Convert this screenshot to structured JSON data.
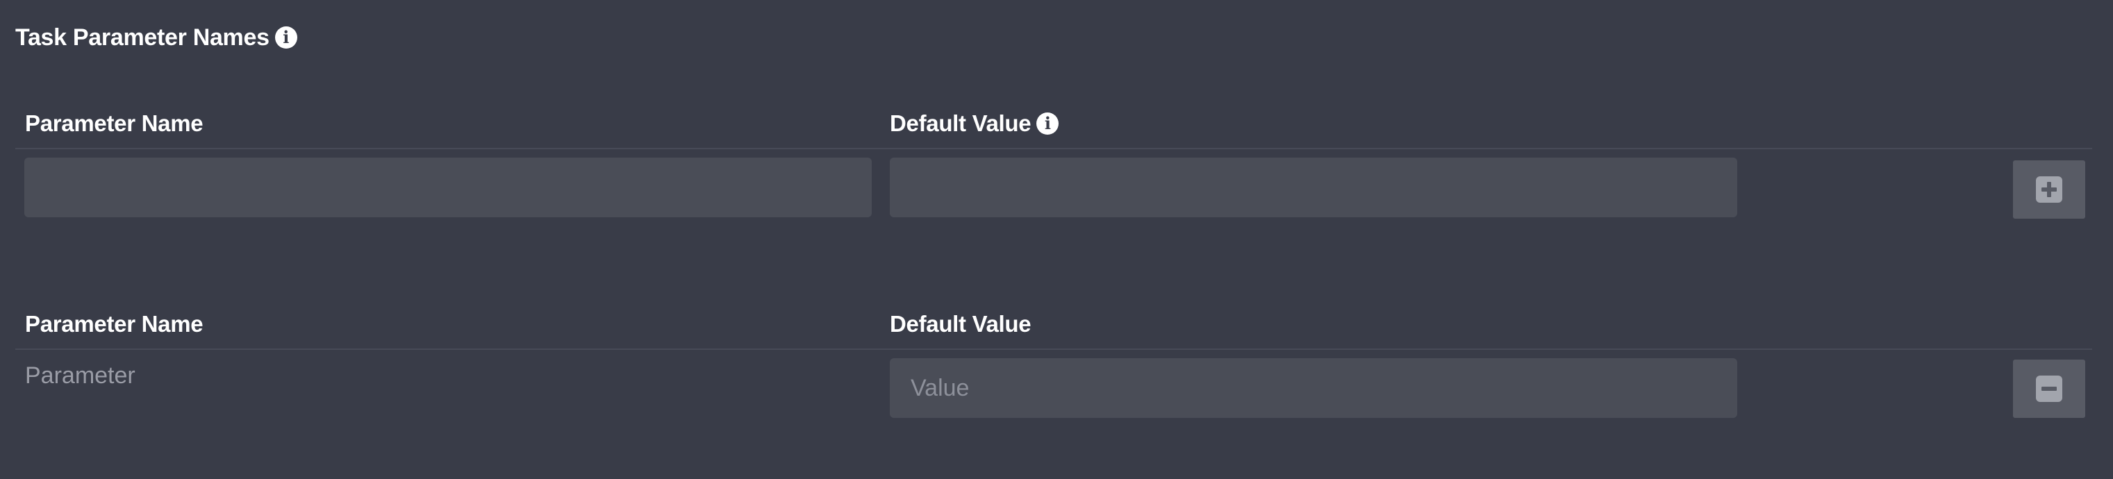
{
  "section": {
    "title": "Task Parameter Names",
    "info_icon": "info-icon"
  },
  "new_row": {
    "header_name": "Parameter Name",
    "header_default": "Default Value",
    "header_default_icon": "info-icon",
    "name_value": "",
    "name_placeholder": "",
    "default_value": "",
    "default_placeholder": "",
    "add_icon": "plus-square-icon"
  },
  "existing_row": {
    "header_name": "Parameter Name",
    "header_default": "Default Value",
    "name_value": "Parameter",
    "default_value": "",
    "default_placeholder": "Value",
    "remove_icon": "minus-square-icon"
  }
}
